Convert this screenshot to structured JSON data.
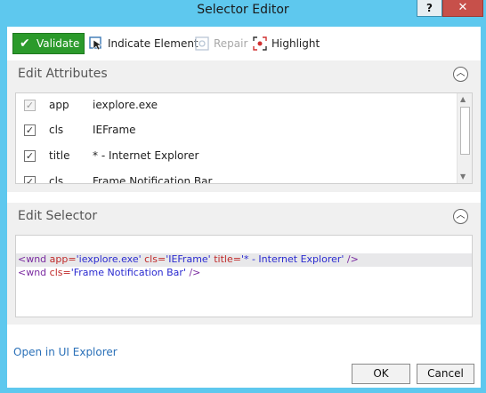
{
  "window": {
    "title": "Selector Editor",
    "help_label": "?",
    "close_label": "✕"
  },
  "toolbar": {
    "validate_label": "Validate",
    "indicate_label": "Indicate Element",
    "repair_label": "Repair",
    "highlight_label": "Highlight"
  },
  "attributes": {
    "header": "Edit Attributes",
    "rows": [
      {
        "checked": true,
        "disabled": true,
        "name": "app",
        "value": "iexplore.exe"
      },
      {
        "checked": true,
        "disabled": false,
        "name": "cls",
        "value": "IEFrame"
      },
      {
        "checked": true,
        "disabled": false,
        "name": "title",
        "value": "* - Internet Explorer"
      },
      {
        "checked": true,
        "disabled": false,
        "name": "cls",
        "value": "Frame Notification Bar"
      }
    ]
  },
  "selector": {
    "header": "Edit Selector",
    "lines": [
      {
        "t1": "<wnd ",
        "a1": "app=",
        "v1": "'iexplore.exe'",
        "s1": " ",
        "a2": "cls=",
        "v2": "'IEFrame'",
        "s2": " ",
        "a3": "title=",
        "v3": "'* - Internet Explorer'",
        "t2": " />"
      },
      {
        "t1": "<wnd ",
        "a1": "cls=",
        "v1": "'Frame Notification Bar'",
        "t2": " />"
      }
    ]
  },
  "footer": {
    "open_link": "Open in UI Explorer",
    "ok_label": "OK",
    "cancel_label": "Cancel"
  },
  "colors": {
    "titlebar": "#5ec8ee",
    "validate": "#2b9a2b",
    "close": "#c7504a",
    "link": "#2a70b8"
  }
}
